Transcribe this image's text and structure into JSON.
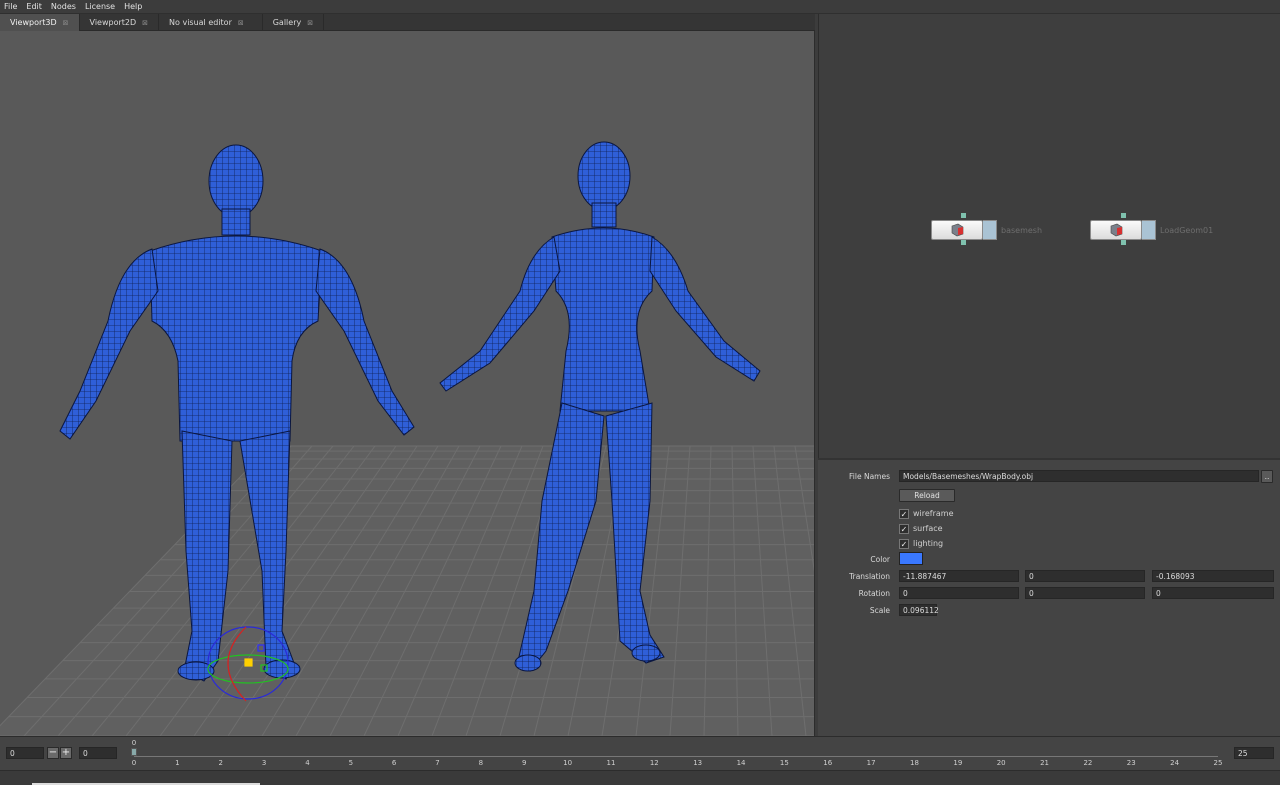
{
  "menu": [
    "File",
    "Edit",
    "Nodes",
    "License",
    "Help"
  ],
  "tabs": [
    {
      "label": "Viewport3D",
      "close": "⊠",
      "active": true
    },
    {
      "label": "Viewport2D",
      "close": "⊠",
      "active": false
    },
    {
      "label": "No visual editor",
      "close": "⊠",
      "active": false
    },
    {
      "label": "Gallery",
      "close": "⊠",
      "active": false
    }
  ],
  "nodes": [
    {
      "label": "basemesh",
      "icon": "geometry-icon"
    },
    {
      "label": "LoadGeom01",
      "icon": "geometry-icon"
    }
  ],
  "props": {
    "file_names_label": "File Names",
    "file_names_value": "Models/Basemeshes/WrapBody.obj",
    "browse_label": "..",
    "reload_label": "Reload",
    "wireframe_label": "wireframe",
    "surface_label": "surface",
    "lighting_label": "lighting",
    "checkmark": "✓",
    "color_label": "Color",
    "color_value": "#3a78ff",
    "translation_label": "Translation",
    "translation": [
      "-11.887467",
      "0",
      "-0.168093"
    ],
    "rotation_label": "Rotation",
    "rotation": [
      "0",
      "0",
      "0"
    ],
    "scale_label": "Scale",
    "scale": "0.096112"
  },
  "timeline": {
    "start": "0",
    "minus": "−",
    "plus": "+",
    "current": "0",
    "marker": "0",
    "end": "25",
    "ticks": [
      "0",
      "1",
      "2",
      "3",
      "4",
      "5",
      "6",
      "7",
      "8",
      "9",
      "10",
      "11",
      "12",
      "13",
      "14",
      "15",
      "16",
      "17",
      "18",
      "19",
      "20",
      "21",
      "22",
      "23",
      "24",
      "25"
    ]
  },
  "colors": {
    "mesh": "#2f5fd8",
    "accent": "#3a78ff",
    "pin": "#7fc1ae"
  }
}
